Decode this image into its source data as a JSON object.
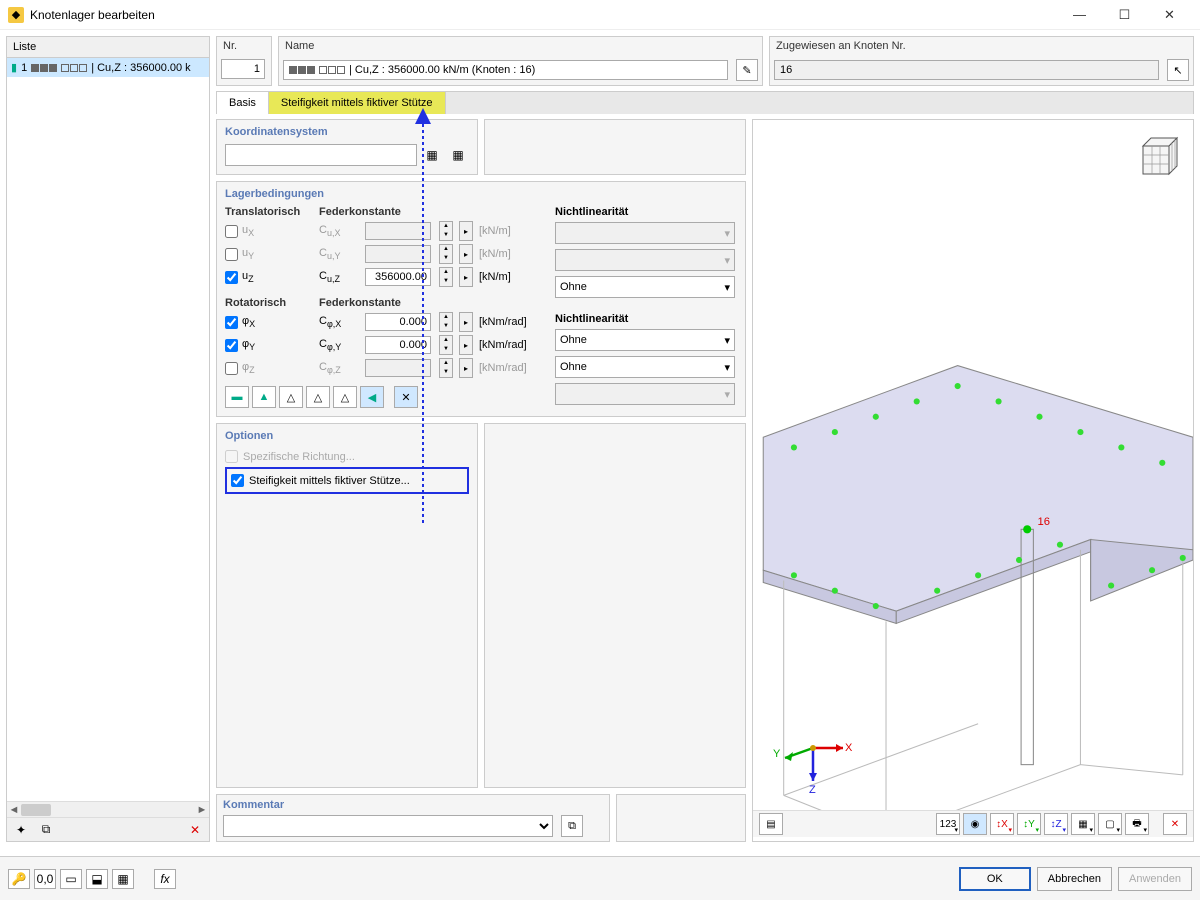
{
  "window": {
    "title": "Knotenlager bearbeiten"
  },
  "list": {
    "header": "Liste",
    "items": [
      {
        "num": "1",
        "label": "| Cu,Z : 356000.00 k"
      }
    ]
  },
  "top": {
    "nr_label": "Nr.",
    "nr_value": "1",
    "name_label": "Name",
    "name_value": "| Cu,Z : 356000.00 kN/m (Knoten : 16)",
    "assign_label": "Zugewiesen an Knoten Nr.",
    "assign_value": "16"
  },
  "tabs": {
    "basis": "Basis",
    "stiff": "Steifigkeit mittels fiktiver Stütze"
  },
  "coord": {
    "title": "Koordinatensystem"
  },
  "support": {
    "title": "Lagerbedingungen",
    "trans_hdr": "Translatorisch",
    "spring_hdr": "Federkonstante",
    "nonlin_hdr": "Nichtlinearität",
    "rot_hdr": "Rotatorisch",
    "rows_t": [
      {
        "chk": false,
        "dof": "uX",
        "c": "Cu,X",
        "val": "",
        "unit": "[kN/m]",
        "nl": ""
      },
      {
        "chk": false,
        "dof": "uY",
        "c": "Cu,Y",
        "val": "",
        "unit": "[kN/m]",
        "nl": ""
      },
      {
        "chk": true,
        "dof": "uZ",
        "c": "Cu,Z",
        "val": "356000.00",
        "unit": "[kN/m]",
        "nl": "Ohne"
      }
    ],
    "rows_r": [
      {
        "chk": true,
        "dof": "φX",
        "c": "Cφ,X",
        "val": "0.000",
        "unit": "[kNm/rad]",
        "nl": "Ohne"
      },
      {
        "chk": true,
        "dof": "φY",
        "c": "Cφ,Y",
        "val": "0.000",
        "unit": "[kNm/rad]",
        "nl": "Ohne"
      },
      {
        "chk": false,
        "dof": "φZ",
        "c": "Cφ,Z",
        "val": "",
        "unit": "[kNm/rad]",
        "nl": ""
      }
    ]
  },
  "options": {
    "title": "Optionen",
    "specific": "Spezifische Richtung...",
    "stiff": "Steifigkeit mittels fiktiver Stütze..."
  },
  "comment": {
    "title": "Kommentar"
  },
  "view": {
    "node_label": "16",
    "axes": {
      "x": "X",
      "y": "Y",
      "z": "Z"
    }
  },
  "buttons": {
    "ok": "OK",
    "cancel": "Abbrechen",
    "apply": "Anwenden"
  }
}
